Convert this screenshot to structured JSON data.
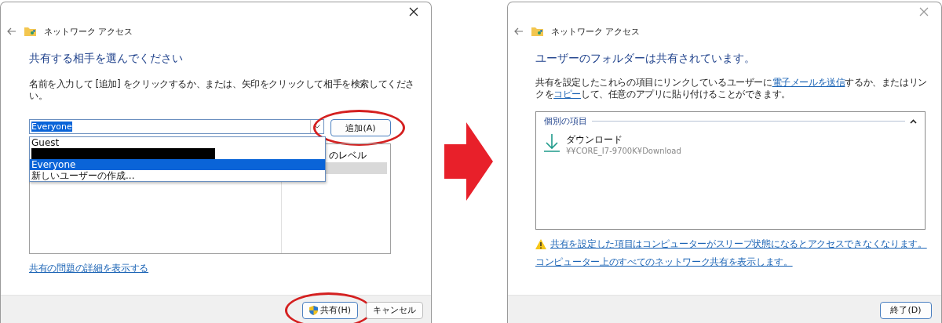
{
  "left_window": {
    "title": "ネットワーク アクセス",
    "heading": "共有する相手を選んでください",
    "instruction": "名前を入力して [追加] をクリックするか、または、矢印をクリックして相手を検索してください。",
    "name_field": {
      "value": "Everyone"
    },
    "add_button": {
      "label": "追加(A)",
      "circled": true
    },
    "dropdown": [
      {
        "kind": "user",
        "label": "Guest",
        "selected": false
      },
      {
        "kind": "redacted",
        "selected": false
      },
      {
        "kind": "user",
        "label": "Everyone",
        "selected": true
      },
      {
        "kind": "user",
        "label": "新しいユーザーの作成...",
        "selected": false
      }
    ],
    "table": {
      "column_2": "のレベル",
      "rows": [
        {
          "selected": true
        }
      ]
    },
    "details_link": "共有の問題の詳細を表示する",
    "buttons": [
      {
        "label": "共有(H)",
        "shield": true,
        "circled": true
      },
      {
        "label": "キャンセル",
        "shield": false,
        "circled": false
      }
    ]
  },
  "right_window": {
    "title": "ネットワーク アクセス",
    "heading": "ユーザーのフォルダーは共有されています。",
    "description": [
      {
        "text": "共有を設定したこれらの項目にリンクしているユーザーに",
        "link": false
      },
      {
        "text": "電子メールを送信",
        "link": true
      },
      {
        "text": "するか、またはリンクを",
        "link": false
      },
      {
        "text": "コピー",
        "link": true
      },
      {
        "text": "して、任意のアプリに貼り付けることができます。",
        "link": false
      }
    ],
    "group": {
      "title": "個別の項目",
      "expanded": true,
      "items": [
        {
          "name": "ダウンロード",
          "path": "¥¥CORE_I7-9700K¥Download"
        }
      ]
    },
    "warning_link": "共有を設定した項目はコンピューターがスリープ状態になるとアクセスできなくなります。",
    "all_shares_link": "コンピューター上のすべてのネットワーク共有を表示します。",
    "buttons": [
      {
        "label": "終了(D)"
      }
    ]
  }
}
